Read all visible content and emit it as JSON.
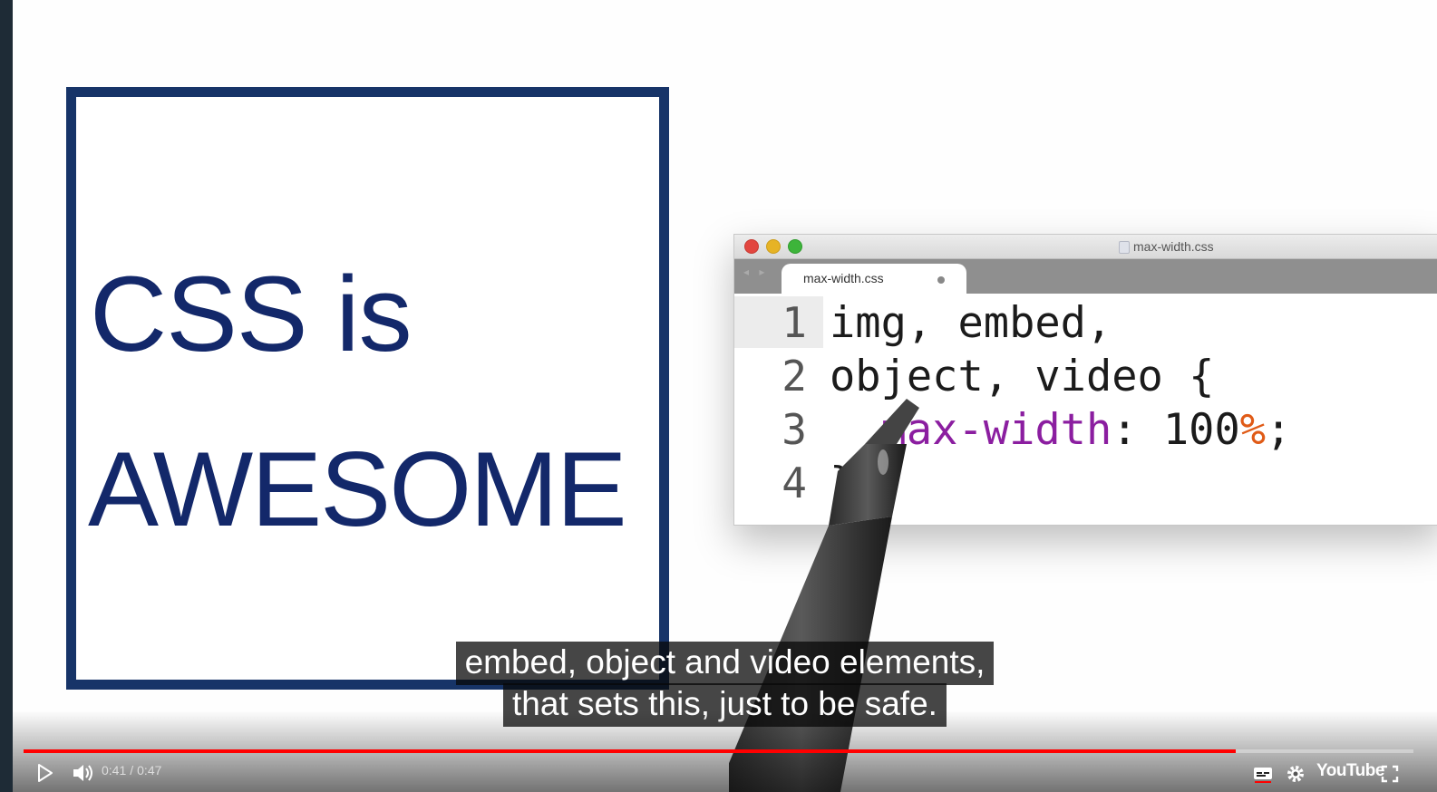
{
  "video": {
    "board_text": {
      "line1": "CSS is",
      "line2": "AWESOME"
    },
    "editor": {
      "window_title": "max-width.css",
      "tab_label": "max-width.css",
      "line_numbers": [
        "1",
        "2",
        "3",
        "4"
      ],
      "code": {
        "line1": "img, embed,",
        "line2": "object, video {",
        "line3_indent": "  ",
        "line3_property": "max-width",
        "line3_colon": ": ",
        "line3_number": "100",
        "line3_unit": "%",
        "line3_end": ";",
        "line4": "}"
      }
    },
    "captions": {
      "line1": "embed, object and video elements,",
      "line2": "that sets this, just to be safe."
    }
  },
  "controls": {
    "current_time": "0:41",
    "separator": "/",
    "duration": "0:47",
    "progress_fraction": 0.872,
    "logo_text": "YouTube",
    "icons": {
      "play": "play-icon",
      "volume": "volume-icon",
      "captions": "captions-icon",
      "settings": "gear-icon",
      "fullscreen": "fullscreen-icon"
    },
    "accent_color": "#ff0000"
  }
}
